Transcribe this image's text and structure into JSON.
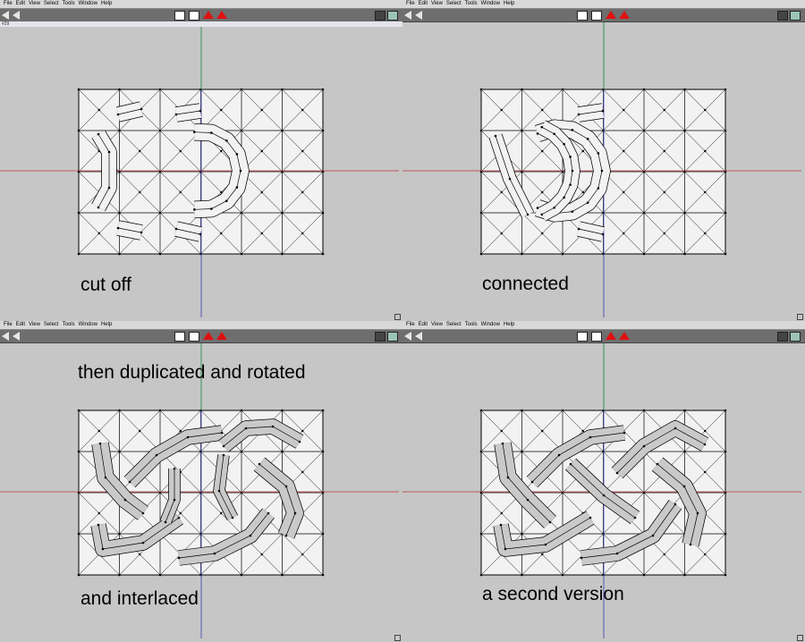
{
  "menu": [
    "File",
    "Edit",
    "View",
    "Select",
    "Tools",
    "Window",
    "Help"
  ],
  "status_label": "#29",
  "panels": [
    {
      "id": "p1",
      "caption": "cut off"
    },
    {
      "id": "p2",
      "caption": "connected"
    },
    {
      "id": "p3",
      "caption": "then duplicated and rotated",
      "caption2": "and interlaced"
    },
    {
      "id": "p4",
      "caption": "a second version"
    }
  ],
  "colors": {
    "grid_fill": "#f2f2f2",
    "x_axis": "#c0303a",
    "z_axis": "#3a3ab4",
    "y_axis": "#30a040",
    "ribbon": "#c9c9c9"
  }
}
